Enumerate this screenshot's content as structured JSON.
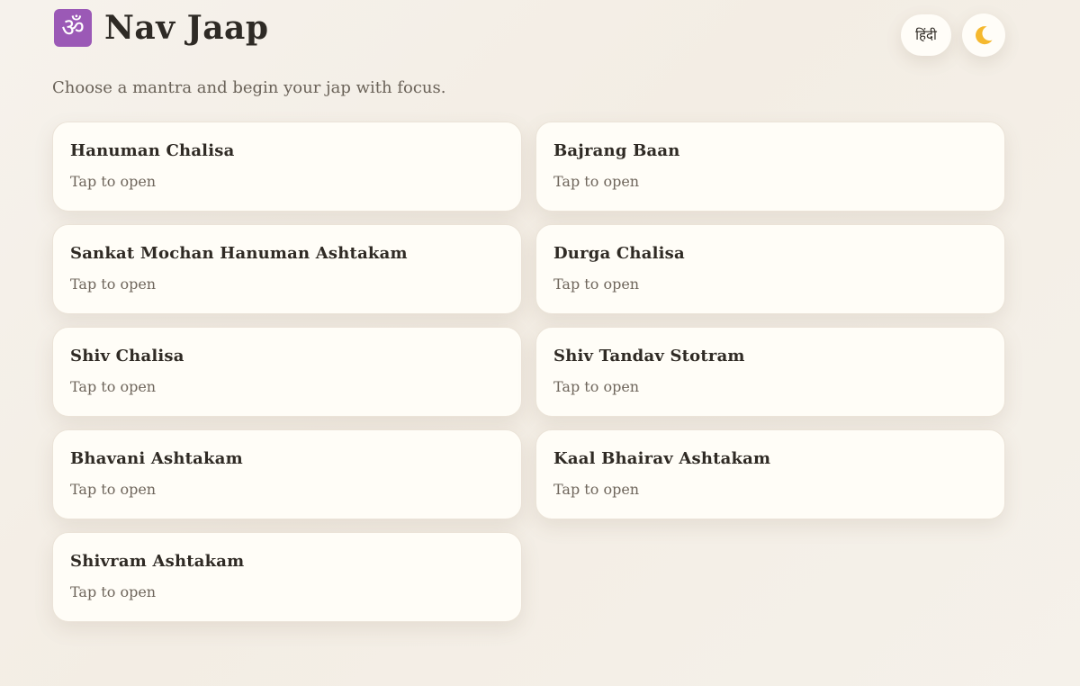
{
  "header": {
    "om_symbol": "ॐ",
    "title": "Nav Jaap",
    "language_toggle_label": "हिंदी",
    "theme_toggle_icon": "crescent-moon-icon"
  },
  "subtitle": "Choose a mantra and begin your jap with focus.",
  "mantras": [
    {
      "title": "Hanuman Chalisa",
      "hint": "Tap to open"
    },
    {
      "title": "Bajrang Baan",
      "hint": "Tap to open"
    },
    {
      "title": "Sankat Mochan Hanuman Ashtakam",
      "hint": "Tap to open"
    },
    {
      "title": "Durga Chalisa",
      "hint": "Tap to open"
    },
    {
      "title": "Shiv Chalisa",
      "hint": "Tap to open"
    },
    {
      "title": "Shiv Tandav Stotram",
      "hint": "Tap to open"
    },
    {
      "title": "Bhavani Ashtakam",
      "hint": "Tap to open"
    },
    {
      "title": "Kaal Bhairav Ashtakam",
      "hint": "Tap to open"
    },
    {
      "title": "Shivram Ashtakam",
      "hint": "Tap to open"
    }
  ],
  "colors": {
    "om_badge": "#9b59b6",
    "moon": "#f5b82e",
    "card_background": "#fffdf7"
  }
}
